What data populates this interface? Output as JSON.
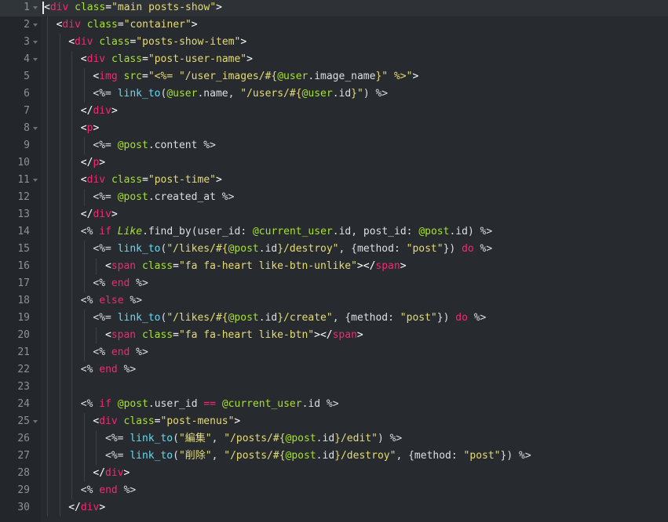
{
  "editor": {
    "current_line": 1,
    "colors": {
      "background": "#272b2f",
      "gutter": "#23272b",
      "tag": "#f92672",
      "attribute": "#a6e22e",
      "string": "#e6db74",
      "function": "#66d9ef",
      "instance_var": "#a6e22e"
    },
    "lines": [
      {
        "n": "1",
        "indent": 0,
        "fold": true,
        "tokens": [
          [
            "pun",
            "<"
          ],
          [
            "tag",
            "div"
          ],
          [
            "pun",
            " "
          ],
          [
            "attr",
            "class"
          ],
          [
            "pun",
            "="
          ],
          [
            "str",
            "\"main posts-show\""
          ],
          [
            "pun",
            ">"
          ]
        ]
      },
      {
        "n": "2",
        "indent": 1,
        "fold": true,
        "tokens": [
          [
            "pun",
            "<"
          ],
          [
            "tag",
            "div"
          ],
          [
            "pun",
            " "
          ],
          [
            "attr",
            "class"
          ],
          [
            "pun",
            "="
          ],
          [
            "str",
            "\"container\""
          ],
          [
            "pun",
            ">"
          ]
        ]
      },
      {
        "n": "3",
        "indent": 2,
        "fold": true,
        "tokens": [
          [
            "pun",
            "<"
          ],
          [
            "tag",
            "div"
          ],
          [
            "pun",
            " "
          ],
          [
            "attr",
            "class"
          ],
          [
            "pun",
            "="
          ],
          [
            "str",
            "\"posts-show-item\""
          ],
          [
            "pun",
            ">"
          ]
        ]
      },
      {
        "n": "4",
        "indent": 3,
        "fold": true,
        "tokens": [
          [
            "pun",
            "<"
          ],
          [
            "tag",
            "div"
          ],
          [
            "pun",
            " "
          ],
          [
            "attr",
            "class"
          ],
          [
            "pun",
            "="
          ],
          [
            "str",
            "\"post-user-name\""
          ],
          [
            "pun",
            ">"
          ]
        ]
      },
      {
        "n": "5",
        "indent": 4,
        "fold": false,
        "tokens": [
          [
            "pun",
            "<"
          ],
          [
            "tag",
            "img"
          ],
          [
            "pun",
            " "
          ],
          [
            "attr",
            "src"
          ],
          [
            "pun",
            "="
          ],
          [
            "str",
            "\"<%= \"/user_images/#{"
          ],
          [
            "ivar",
            "@user"
          ],
          [
            "punc",
            "."
          ],
          [
            "plain",
            "image_name"
          ],
          [
            "str",
            "}\" %>\""
          ],
          [
            "pun",
            ">"
          ]
        ]
      },
      {
        "n": "6",
        "indent": 4,
        "fold": false,
        "tokens": [
          [
            "punc",
            "<%= "
          ],
          [
            "func",
            "link_to"
          ],
          [
            "punc",
            "("
          ],
          [
            "ivar",
            "@user"
          ],
          [
            "punc",
            "."
          ],
          [
            "plain",
            "name"
          ],
          [
            "punc",
            ", "
          ],
          [
            "str",
            "\"/users/#{"
          ],
          [
            "ivar",
            "@user"
          ],
          [
            "punc",
            "."
          ],
          [
            "plain",
            "id"
          ],
          [
            "str",
            "}\""
          ],
          [
            "punc",
            ") %>"
          ]
        ]
      },
      {
        "n": "7",
        "indent": 3,
        "fold": false,
        "tokens": [
          [
            "pun",
            "</"
          ],
          [
            "tag",
            "div"
          ],
          [
            "pun",
            ">"
          ]
        ]
      },
      {
        "n": "8",
        "indent": 3,
        "fold": true,
        "tokens": [
          [
            "pun",
            "<"
          ],
          [
            "tag",
            "p"
          ],
          [
            "pun",
            ">"
          ]
        ]
      },
      {
        "n": "9",
        "indent": 4,
        "fold": false,
        "tokens": [
          [
            "punc",
            "<%= "
          ],
          [
            "ivar",
            "@post"
          ],
          [
            "punc",
            "."
          ],
          [
            "plain",
            "content"
          ],
          [
            "punc",
            " %>"
          ]
        ]
      },
      {
        "n": "10",
        "indent": 3,
        "fold": false,
        "tokens": [
          [
            "pun",
            "</"
          ],
          [
            "tag",
            "p"
          ],
          [
            "pun",
            ">"
          ]
        ]
      },
      {
        "n": "11",
        "indent": 3,
        "fold": true,
        "tokens": [
          [
            "pun",
            "<"
          ],
          [
            "tag",
            "div"
          ],
          [
            "pun",
            " "
          ],
          [
            "attr",
            "class"
          ],
          [
            "pun",
            "="
          ],
          [
            "str",
            "\"post-time\""
          ],
          [
            "pun",
            ">"
          ]
        ]
      },
      {
        "n": "12",
        "indent": 4,
        "fold": false,
        "tokens": [
          [
            "punc",
            "<%= "
          ],
          [
            "ivar",
            "@post"
          ],
          [
            "punc",
            "."
          ],
          [
            "plain",
            "created_at"
          ],
          [
            "punc",
            " %>"
          ]
        ]
      },
      {
        "n": "13",
        "indent": 3,
        "fold": false,
        "tokens": [
          [
            "pun",
            "</"
          ],
          [
            "tag",
            "div"
          ],
          [
            "pun",
            ">"
          ]
        ]
      },
      {
        "n": "14",
        "indent": 3,
        "fold": false,
        "tokens": [
          [
            "punc",
            "<% "
          ],
          [
            "kw",
            "if"
          ],
          [
            "punc",
            " "
          ],
          [
            "const",
            "Like"
          ],
          [
            "punc",
            "."
          ],
          [
            "plain",
            "find_by"
          ],
          [
            "punc",
            "("
          ],
          [
            "plain",
            "user_id"
          ],
          [
            "punc",
            ": "
          ],
          [
            "ivar",
            "@current_user"
          ],
          [
            "punc",
            "."
          ],
          [
            "plain",
            "id"
          ],
          [
            "punc",
            ", "
          ],
          [
            "plain",
            "post_id"
          ],
          [
            "punc",
            ": "
          ],
          [
            "ivar",
            "@post"
          ],
          [
            "punc",
            "."
          ],
          [
            "plain",
            "id"
          ],
          [
            "punc",
            ") %>"
          ]
        ]
      },
      {
        "n": "15",
        "indent": 4,
        "fold": false,
        "tokens": [
          [
            "punc",
            "<%= "
          ],
          [
            "func",
            "link_to"
          ],
          [
            "punc",
            "("
          ],
          [
            "str",
            "\"/likes/#{"
          ],
          [
            "ivar",
            "@post"
          ],
          [
            "punc",
            "."
          ],
          [
            "plain",
            "id"
          ],
          [
            "str",
            "}/destroy\""
          ],
          [
            "punc",
            ", {"
          ],
          [
            "plain",
            "method"
          ],
          [
            "punc",
            ": "
          ],
          [
            "str",
            "\"post\""
          ],
          [
            "punc",
            "}) "
          ],
          [
            "kw",
            "do"
          ],
          [
            "punc",
            " %>"
          ]
        ]
      },
      {
        "n": "16",
        "indent": 5,
        "fold": false,
        "tokens": [
          [
            "pun",
            "<"
          ],
          [
            "tag",
            "span"
          ],
          [
            "pun",
            " "
          ],
          [
            "attr",
            "class"
          ],
          [
            "pun",
            "="
          ],
          [
            "str",
            "\"fa fa-heart like-btn-unlike\""
          ],
          [
            "pun",
            "></"
          ],
          [
            "tag",
            "span"
          ],
          [
            "pun",
            ">"
          ]
        ]
      },
      {
        "n": "17",
        "indent": 4,
        "fold": false,
        "tokens": [
          [
            "punc",
            "<% "
          ],
          [
            "kw",
            "end"
          ],
          [
            "punc",
            " %>"
          ]
        ]
      },
      {
        "n": "18",
        "indent": 3,
        "fold": false,
        "tokens": [
          [
            "punc",
            "<% "
          ],
          [
            "kw",
            "else"
          ],
          [
            "punc",
            " %>"
          ]
        ]
      },
      {
        "n": "19",
        "indent": 4,
        "fold": false,
        "tokens": [
          [
            "punc",
            "<%= "
          ],
          [
            "func",
            "link_to"
          ],
          [
            "punc",
            "("
          ],
          [
            "str",
            "\"/likes/#{"
          ],
          [
            "ivar",
            "@post"
          ],
          [
            "punc",
            "."
          ],
          [
            "plain",
            "id"
          ],
          [
            "str",
            "}/create\""
          ],
          [
            "punc",
            ", {"
          ],
          [
            "plain",
            "method"
          ],
          [
            "punc",
            ": "
          ],
          [
            "str",
            "\"post\""
          ],
          [
            "punc",
            "}) "
          ],
          [
            "kw",
            "do"
          ],
          [
            "punc",
            " %>"
          ]
        ]
      },
      {
        "n": "20",
        "indent": 5,
        "fold": false,
        "tokens": [
          [
            "pun",
            "<"
          ],
          [
            "tag",
            "span"
          ],
          [
            "pun",
            " "
          ],
          [
            "attr",
            "class"
          ],
          [
            "pun",
            "="
          ],
          [
            "str",
            "\"fa fa-heart like-btn\""
          ],
          [
            "pun",
            "></"
          ],
          [
            "tag",
            "span"
          ],
          [
            "pun",
            ">"
          ]
        ]
      },
      {
        "n": "21",
        "indent": 4,
        "fold": false,
        "tokens": [
          [
            "punc",
            "<% "
          ],
          [
            "kw",
            "end"
          ],
          [
            "punc",
            " %>"
          ]
        ]
      },
      {
        "n": "22",
        "indent": 3,
        "fold": false,
        "tokens": [
          [
            "punc",
            "<% "
          ],
          [
            "kw",
            "end"
          ],
          [
            "punc",
            " %>"
          ]
        ]
      },
      {
        "n": "23",
        "indent": 3,
        "fold": false,
        "tokens": []
      },
      {
        "n": "24",
        "indent": 3,
        "fold": false,
        "tokens": [
          [
            "punc",
            "<% "
          ],
          [
            "kw",
            "if"
          ],
          [
            "punc",
            " "
          ],
          [
            "ivar",
            "@post"
          ],
          [
            "punc",
            "."
          ],
          [
            "plain",
            "user_id"
          ],
          [
            "punc",
            " "
          ],
          [
            "kw",
            "=="
          ],
          [
            "punc",
            " "
          ],
          [
            "ivar",
            "@current_user"
          ],
          [
            "punc",
            "."
          ],
          [
            "plain",
            "id"
          ],
          [
            "punc",
            " %>"
          ]
        ]
      },
      {
        "n": "25",
        "indent": 4,
        "fold": true,
        "tokens": [
          [
            "pun",
            "<"
          ],
          [
            "tag",
            "div"
          ],
          [
            "pun",
            " "
          ],
          [
            "attr",
            "class"
          ],
          [
            "pun",
            "="
          ],
          [
            "str",
            "\"post-menus\""
          ],
          [
            "pun",
            ">"
          ]
        ]
      },
      {
        "n": "26",
        "indent": 5,
        "fold": false,
        "tokens": [
          [
            "punc",
            "<%= "
          ],
          [
            "func",
            "link_to"
          ],
          [
            "punc",
            "("
          ],
          [
            "str",
            "\"編集\""
          ],
          [
            "punc",
            ", "
          ],
          [
            "str",
            "\"/posts/#{"
          ],
          [
            "ivar",
            "@post"
          ],
          [
            "punc",
            "."
          ],
          [
            "plain",
            "id"
          ],
          [
            "str",
            "}/edit\""
          ],
          [
            "punc",
            ") %>"
          ]
        ]
      },
      {
        "n": "27",
        "indent": 5,
        "fold": false,
        "tokens": [
          [
            "punc",
            "<%= "
          ],
          [
            "func",
            "link_to"
          ],
          [
            "punc",
            "("
          ],
          [
            "str",
            "\"削除\""
          ],
          [
            "punc",
            ", "
          ],
          [
            "str",
            "\"/posts/#{"
          ],
          [
            "ivar",
            "@post"
          ],
          [
            "punc",
            "."
          ],
          [
            "plain",
            "id"
          ],
          [
            "str",
            "}/destroy\""
          ],
          [
            "punc",
            ", {"
          ],
          [
            "plain",
            "method"
          ],
          [
            "punc",
            ": "
          ],
          [
            "str",
            "\"post\""
          ],
          [
            "punc",
            "}) %>"
          ]
        ]
      },
      {
        "n": "28",
        "indent": 4,
        "fold": false,
        "tokens": [
          [
            "pun",
            "</"
          ],
          [
            "tag",
            "div"
          ],
          [
            "pun",
            ">"
          ]
        ]
      },
      {
        "n": "29",
        "indent": 3,
        "fold": false,
        "tokens": [
          [
            "punc",
            "<% "
          ],
          [
            "kw",
            "end"
          ],
          [
            "punc",
            " %>"
          ]
        ]
      },
      {
        "n": "30",
        "indent": 2,
        "fold": false,
        "tokens": [
          [
            "pun",
            "</"
          ],
          [
            "tag",
            "div"
          ],
          [
            "pun",
            ">"
          ]
        ]
      }
    ]
  }
}
